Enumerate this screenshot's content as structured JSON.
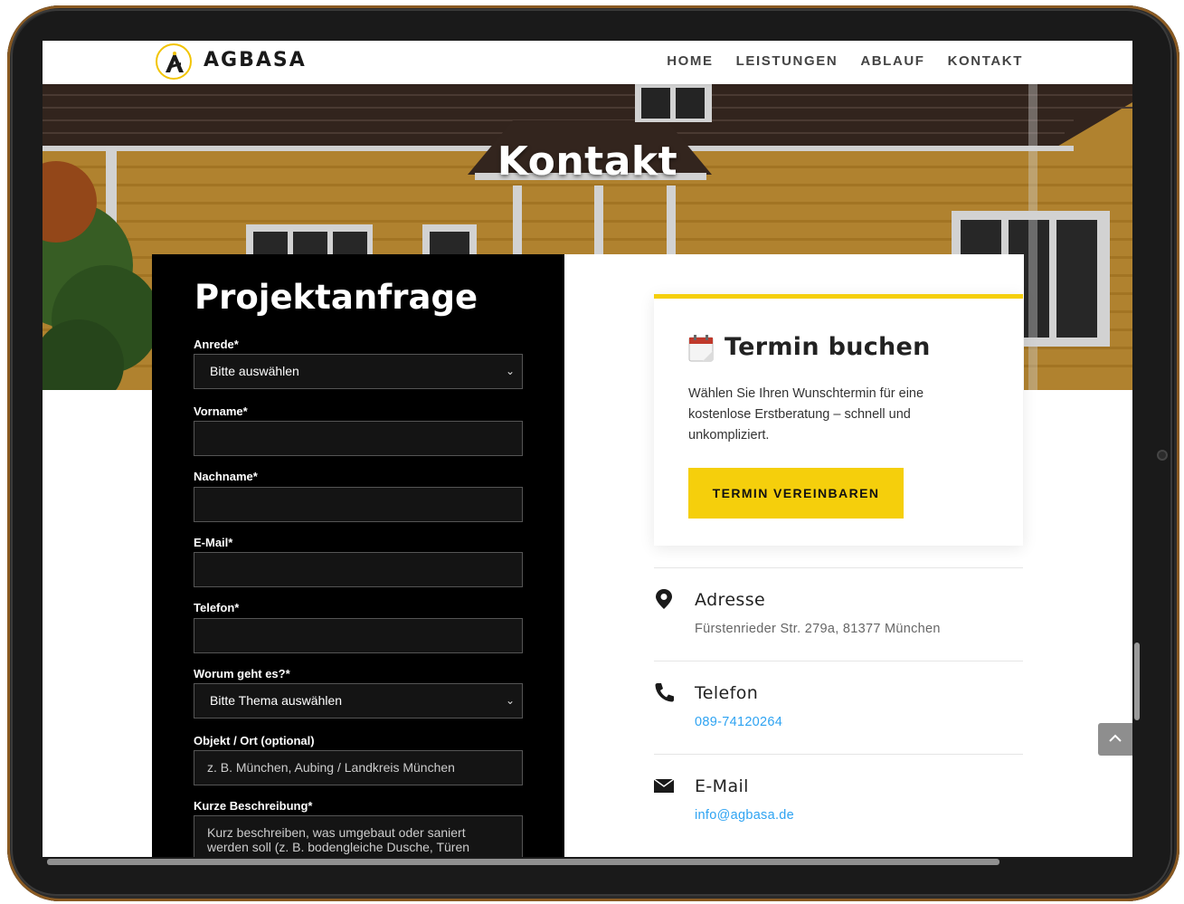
{
  "brand": {
    "name": "AGBASA",
    "accent": "#f5cf0c"
  },
  "nav": {
    "items": [
      "HOME",
      "LEISTUNGEN",
      "ABLAUF",
      "KONTAKT"
    ]
  },
  "hero": {
    "title": "Kontakt"
  },
  "form": {
    "title": "Projektanfrage",
    "anrede_label": "Anrede*",
    "anrede_value": "Bitte auswählen",
    "vorname_label": "Vorname*",
    "nachname_label": "Nachname*",
    "email_label": "E-Mail*",
    "telefon_label": "Telefon*",
    "thema_label": "Worum geht es?*",
    "thema_value": "Bitte Thema auswählen",
    "objekt_label": "Objekt / Ort (optional)",
    "objekt_placeholder": "z. B. München, Aubing / Landkreis München",
    "beschreibung_label": "Kurze Beschreibung*",
    "beschreibung_placeholder": "Kurz beschreiben, was umgebaut oder saniert werden soll (z. B. bodengleiche Dusche, Türen"
  },
  "termin": {
    "icon": "calendar-icon",
    "title": "Termin buchen",
    "text": "Wählen Sie Ihren Wunschtermin für eine kostenlose Erstberatung – schnell und unkompliziert.",
    "button": "TERMIN VEREINBAREN"
  },
  "contact": {
    "address_title": "Adresse",
    "address_value": "Fürstenrieder Str. 279a, 81377 München",
    "phone_title": "Telefon",
    "phone_value": "089-74120264",
    "email_title": "E-Mail",
    "email_value": "info@agbasa.de",
    "link_color": "#2ea3f2"
  }
}
